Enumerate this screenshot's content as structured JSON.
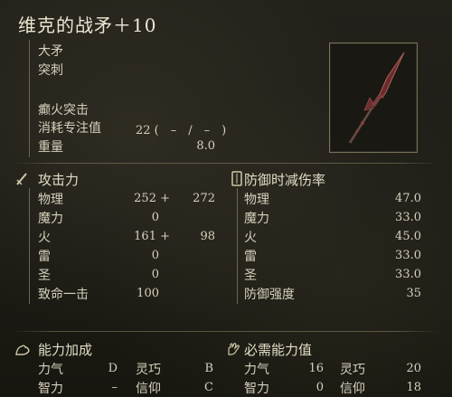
{
  "weapon": {
    "name": "维克的战矛＋10",
    "type": "大矛",
    "attack_type": "突刺",
    "skill": "癫火突击",
    "fp_cost_label": "消耗专注值",
    "fp_cost_value": "22 (　–　/　–　)",
    "weight_label": "重量",
    "weight_value": "8.0"
  },
  "attack": {
    "header": "攻击力",
    "rows": [
      {
        "label": "物理",
        "base": "252 +",
        "bonus": "272"
      },
      {
        "label": "魔力",
        "base": "0",
        "bonus": ""
      },
      {
        "label": "火",
        "base": "161 +",
        "bonus": "98"
      },
      {
        "label": "雷",
        "base": "0",
        "bonus": ""
      },
      {
        "label": "圣",
        "base": "0",
        "bonus": ""
      },
      {
        "label": "致命一击",
        "base": "100",
        "bonus": ""
      }
    ]
  },
  "guard": {
    "header": "防御时减伤率",
    "rows": [
      {
        "label": "物理",
        "value": "47.0"
      },
      {
        "label": "魔力",
        "value": "33.0"
      },
      {
        "label": "火",
        "value": "45.0"
      },
      {
        "label": "雷",
        "value": "33.0"
      },
      {
        "label": "圣",
        "value": "33.0"
      },
      {
        "label": "防御强度",
        "value": "35"
      }
    ]
  },
  "scaling": {
    "header": "能力加成",
    "rows": [
      {
        "a_label": "力气",
        "a_value": "D",
        "b_label": "灵巧",
        "b_value": "B"
      },
      {
        "a_label": "智力",
        "a_value": "–",
        "b_label": "信仰",
        "b_value": "C"
      }
    ]
  },
  "requirements": {
    "header": "必需能力值",
    "rows": [
      {
        "a_label": "力气",
        "a_value": "16",
        "b_label": "灵巧",
        "b_value": "20"
      },
      {
        "a_label": "智力",
        "a_value": "0",
        "b_label": "信仰",
        "b_value": "18"
      }
    ]
  },
  "icons": {
    "attack": "sword-icon",
    "guard": "shield-icon",
    "scaling": "flexed-arm-icon",
    "requirements": "hand-icon",
    "weapon": "spear-image"
  }
}
